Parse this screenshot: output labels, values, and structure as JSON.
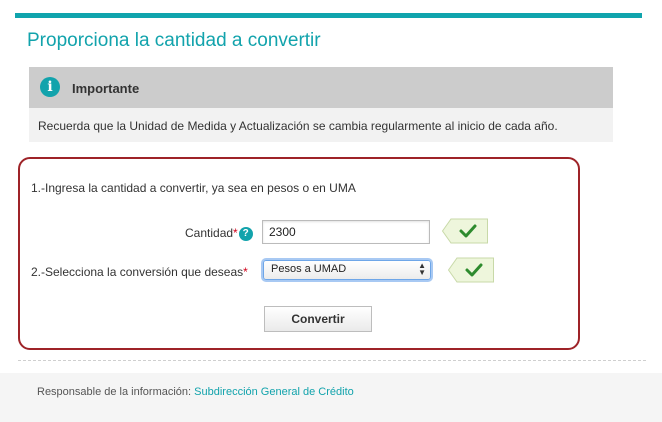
{
  "header": {
    "title": "Proporciona la cantidad a convertir"
  },
  "notice": {
    "icon": "info-icon",
    "title": "Importante",
    "text": "Recuerda que la Unidad de Medida y Actualización se cambia regularmente al inicio de cada año."
  },
  "form": {
    "step1": "1.-Ingresa la cantidad a convertir, ya sea en pesos o en UMA",
    "quantity_label": "Cantidad",
    "required_mark": "*",
    "help_glyph": "?",
    "quantity_value": "2300",
    "step2": "2.-Selecciona la conversión que deseas",
    "conversion_selected": "Pesos a UMAD",
    "convert_button": "Convertir",
    "valid_icon": "checkmark-icon"
  },
  "footer": {
    "label": "Responsable de la información:",
    "link_text": "Subdirección General de Crédito"
  },
  "colors": {
    "accent": "#12a3ac",
    "form_border": "#9e2328",
    "required": "#d0021b",
    "check_green": "#2e8b2e",
    "check_bg": "#eef6dc"
  }
}
